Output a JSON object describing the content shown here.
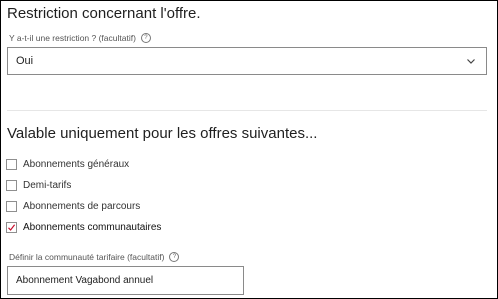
{
  "restriction": {
    "title": "Restriction concernant l'offre.",
    "field_label": "Y a-t-il une restriction ? (facultatif)",
    "info_icon": "info-icon",
    "selected_value": "Oui"
  },
  "valid_offers": {
    "title": "Valable uniquement pour les offres suivantes...",
    "options": [
      {
        "label": "Abonnements généraux",
        "checked": false
      },
      {
        "label": "Demi-tarifs",
        "checked": false
      },
      {
        "label": "Abonnements de parcours",
        "checked": false
      },
      {
        "label": "Abonnements communautaires",
        "checked": true
      }
    ]
  },
  "community": {
    "field_label": "Définir la communauté tarifaire (facultatif)",
    "value": "Abonnement Vagabond annuel"
  },
  "colors": {
    "checkmark": "#c8102e",
    "border": "#8a8a8a"
  }
}
